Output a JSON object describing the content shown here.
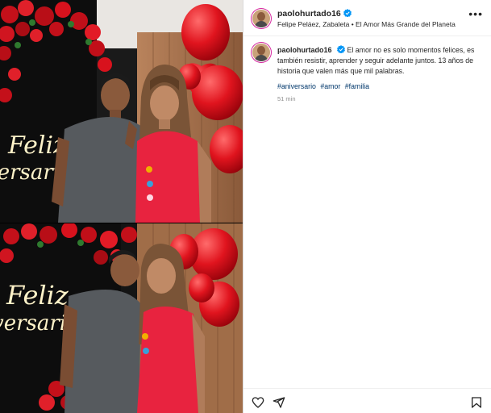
{
  "post": {
    "username": "paolohurtado16",
    "location": "Felipe Peláez, Zabaleta",
    "audio_separator": "•",
    "audio": "El Amor Más Grande del Planeta",
    "more_label": "•••"
  },
  "caption": {
    "username": "paolohurtado16",
    "text": "El amor no es solo momentos felices, es también resistir, aprender y seguir adelante juntos. 13 años de historia que valen más que mil palabras.",
    "hashtags": [
      "#aniversario",
      "#amor",
      "#familia"
    ],
    "time_ago": "51 min"
  },
  "media": {
    "sign_line1": "Feliz",
    "sign_line2": "Aniversario",
    "photos": [
      "couple-posing-photo",
      "couple-kiss-photo"
    ]
  },
  "colors": {
    "verified": "#0095f6",
    "hashtag": "#00376b",
    "balloon": "#e0141e",
    "dress": "#e8233f"
  },
  "icons": [
    "verified-icon",
    "heart-icon",
    "share-icon",
    "bookmark-icon"
  ]
}
